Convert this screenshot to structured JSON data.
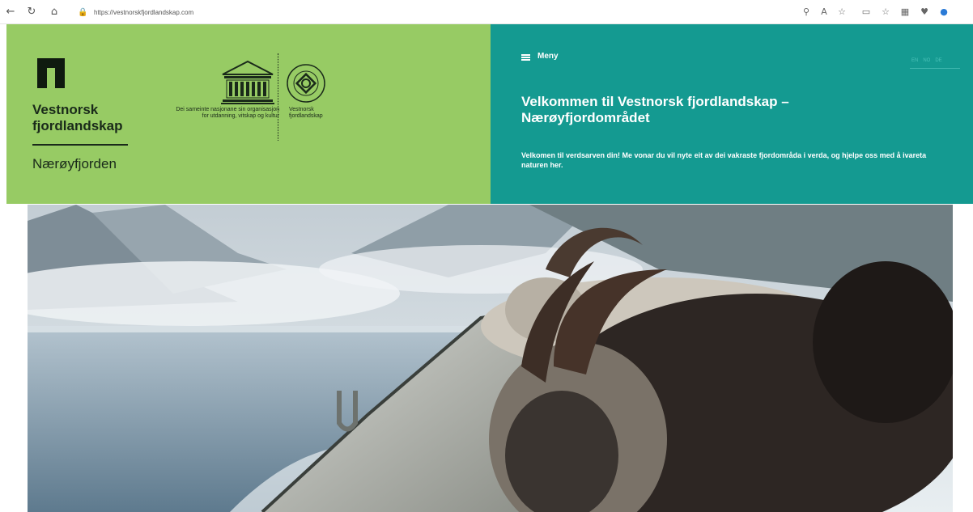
{
  "browser": {
    "url": "https://vestnorskfjordlandskap.com",
    "back_glyph": "←",
    "reload_glyph": "↻",
    "home_glyph": "⌂",
    "lock_glyph": "🔒",
    "toolbar_glyphs": [
      "⚲",
      "A",
      "☆",
      "▭",
      "☆",
      "▦",
      "♥",
      "●"
    ]
  },
  "header": {
    "site_title": "Vestnorsk fjordlandskap",
    "site_subtitle": "Nærøyfjorden",
    "unesco_caption": "Dei sameinte nasjonane sin organisasjon for utdanning, vitskap og kultur",
    "whc_caption": "Vestnorsk fjordlandskap",
    "menu_label": "Meny",
    "languages": [
      "EN",
      "NO",
      "DE"
    ],
    "welcome_title": "Velkommen til Vestnorsk fjordlandskap – Nærøyfjordområdet",
    "welcome_text": "Velkomen til verdsarven din! Me vonar du vil nyte eit av dei vakraste fjordområda i verda, og hjelpe oss med å ivareta naturen her."
  },
  "colors": {
    "green_panel": "#97cb64",
    "teal_panel": "#149a91",
    "dark_text": "#1a2a1a"
  }
}
